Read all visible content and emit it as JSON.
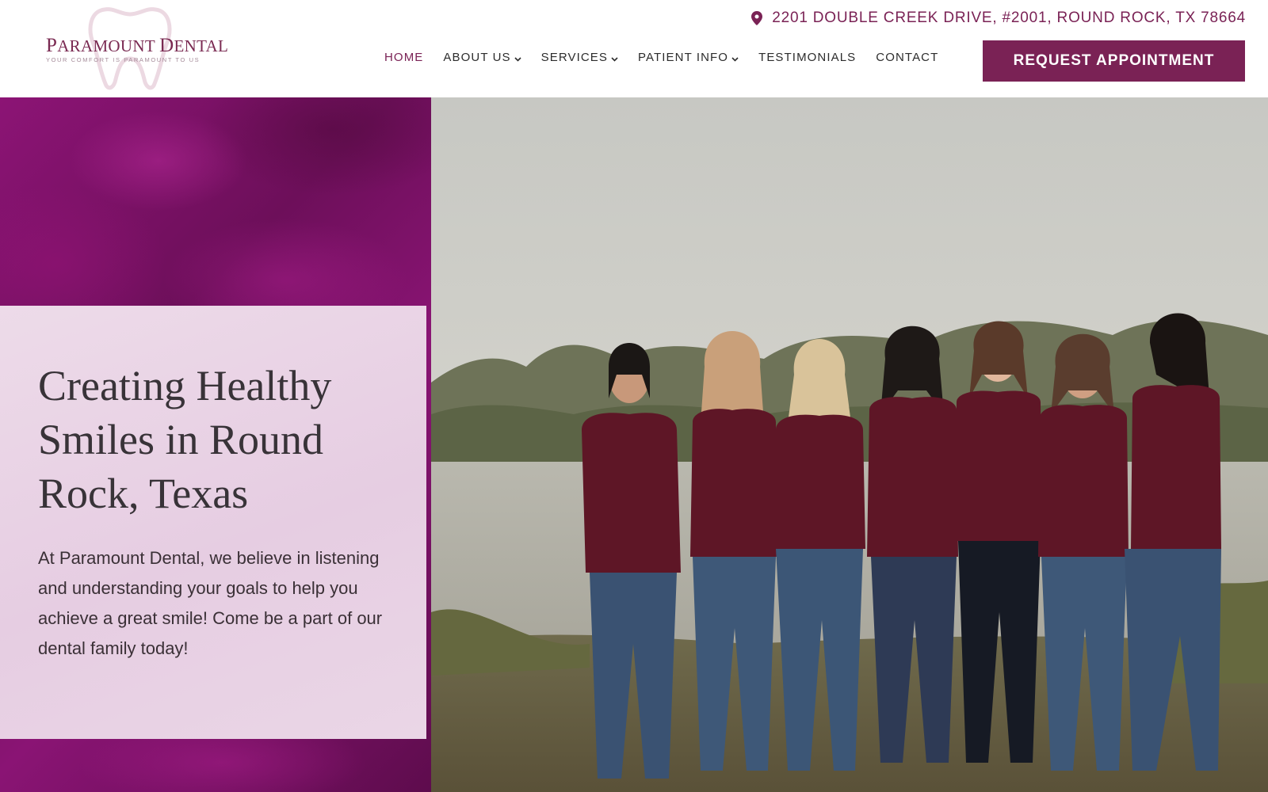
{
  "logo": {
    "name_first_cap": "P",
    "name_first_rest": "ARAMOUNT ",
    "name_second_cap": "D",
    "name_second_rest": "ENTAL",
    "tagline": "YOUR COMFORT IS PARAMOUNT TO US",
    "icon": "tooth-outline-icon"
  },
  "header": {
    "address": "2201 DOUBLE CREEK DRIVE, #2001, ROUND ROCK, TX 78664",
    "address_icon": "map-pin-icon",
    "cta_label": "REQUEST APPOINTMENT"
  },
  "nav": {
    "items": [
      {
        "label": "HOME",
        "active": true,
        "dropdown": false
      },
      {
        "label": "ABOUT US",
        "active": false,
        "dropdown": true
      },
      {
        "label": "SERVICES",
        "active": false,
        "dropdown": true
      },
      {
        "label": "PATIENT INFO",
        "active": false,
        "dropdown": true
      },
      {
        "label": "TESTIMONIALS",
        "active": false,
        "dropdown": false
      },
      {
        "label": "CONTACT",
        "active": false,
        "dropdown": false
      }
    ]
  },
  "hero": {
    "heading": "Creating Healthy Smiles in Round Rock, Texas",
    "body": "At Paramount Dental, we believe in listening and understanding your goals to help you achieve a great smile! Come be a part of our dental family today!"
  },
  "colors": {
    "brand": "#7a2255",
    "panel": "#7c1266",
    "card": "#e8d3e4",
    "scrub_shirt": "#5e1626",
    "jeans": "#3a5272"
  }
}
